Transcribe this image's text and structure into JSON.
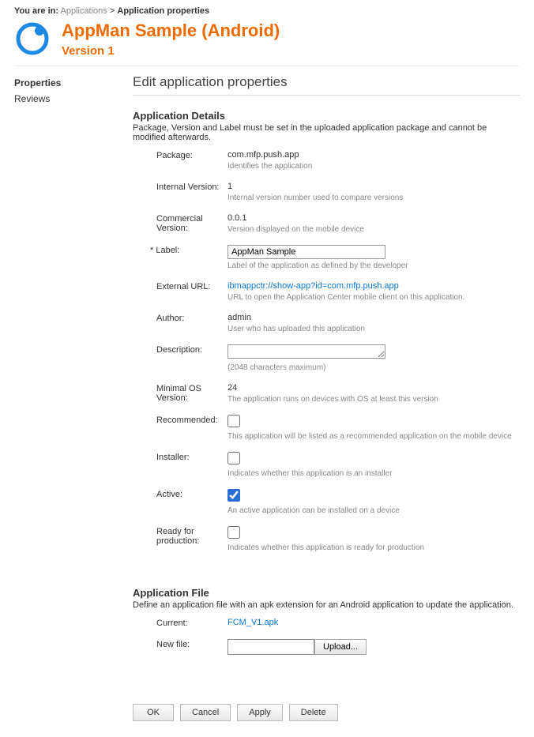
{
  "breadcrumb": {
    "prefix": "You are in:",
    "link": "Applications",
    "sep": ">",
    "current": "Application properties"
  },
  "header": {
    "title": "AppMan Sample (Android)",
    "version": "Version 1"
  },
  "sidebar": {
    "items": [
      {
        "label": "Properties",
        "selected": true
      },
      {
        "label": "Reviews",
        "selected": false
      }
    ]
  },
  "main": {
    "page_title": "Edit application properties",
    "section_details": {
      "title": "Application Details",
      "desc": "Package, Version and Label must be set in the uploaded application package and cannot be modified afterwards."
    },
    "fields": {
      "package": {
        "label": "Package:",
        "value": "com.mfp.push.app",
        "help": "Identifies the application"
      },
      "internal_version": {
        "label": "Internal Version:",
        "value": "1",
        "help": "Internal version number used to compare versions"
      },
      "commercial_version": {
        "label": "Commercial Version:",
        "value": "0.0.1",
        "help": "Version displayed on the mobile device"
      },
      "label": {
        "label": "* Label:",
        "value": "AppMan Sample",
        "help": "Label of the application as defined by the developer"
      },
      "external_url": {
        "label": "External URL:",
        "value": "ibmappctr://show-app?id=com.mfp.push.app",
        "help": "URL to open the Application Center mobile client on this application."
      },
      "author": {
        "label": "Author:",
        "value": "admin",
        "help": "User who has uploaded this application"
      },
      "description": {
        "label": "Description:",
        "value": "",
        "help": "(2048 characters maximum)"
      },
      "min_os": {
        "label": "Minimal OS Version:",
        "value": "24",
        "help": "The application runs on devices with OS at least this version"
      },
      "recommended": {
        "label": "Recommended:",
        "checked": false,
        "help": "This application will be listed as a recommended application on the mobile device"
      },
      "installer": {
        "label": "Installer:",
        "checked": false,
        "help": "Indicates whether this application is an installer"
      },
      "active": {
        "label": "Active:",
        "checked": true,
        "help": "An active application can be installed on a device"
      },
      "ready": {
        "label": "Ready for production:",
        "checked": false,
        "help": "Indicates whether this application is ready for production"
      }
    },
    "section_file": {
      "title": "Application File",
      "desc": "Define an application file with an apk extension for an Android application to update the application.",
      "current": {
        "label": "Current:",
        "value": "FCM_V1.apk"
      },
      "newfile": {
        "label": "New file:",
        "upload_label": "Upload..."
      }
    },
    "buttons": {
      "ok": "OK",
      "cancel": "Cancel",
      "apply": "Apply",
      "delete": "Delete"
    }
  }
}
